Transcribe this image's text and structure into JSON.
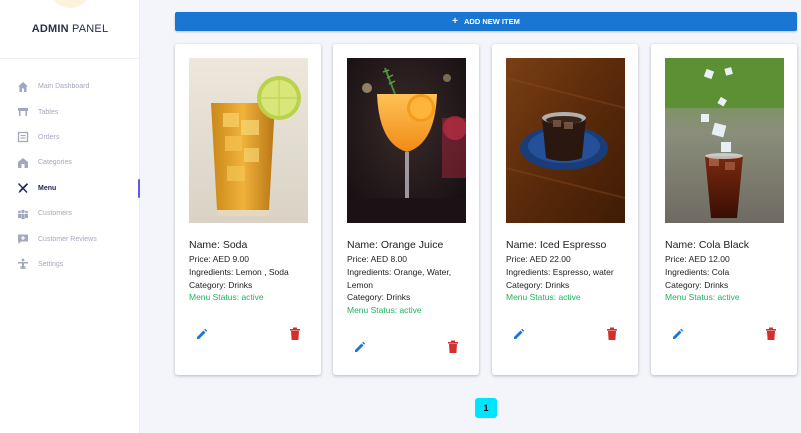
{
  "brand": {
    "bold": "ADMIN",
    "regular": " PANEL"
  },
  "nav": [
    {
      "label": "Main Dashboard",
      "icon": "home-icon"
    },
    {
      "label": "Tables",
      "icon": "table-icon"
    },
    {
      "label": "Orders",
      "icon": "orders-icon"
    },
    {
      "label": "Categories",
      "icon": "categories-icon"
    },
    {
      "label": "Menu",
      "icon": "utensils-icon",
      "active": true
    },
    {
      "label": "Customers",
      "icon": "customers-icon"
    },
    {
      "label": "Customer Reviews",
      "icon": "reviews-icon"
    },
    {
      "label": "Settings",
      "icon": "settings-icon"
    }
  ],
  "toolbar": {
    "add_label": "ADD NEW ITEM"
  },
  "items": [
    {
      "name": "Name: Soda",
      "price": "Price: AED 9.00",
      "ingredients": "Ingredients: Lemon , Soda",
      "category": "Category: Drinks",
      "status": "Menu Status: active"
    },
    {
      "name": "Name: Orange Juice",
      "price": "Price: AED 8.00",
      "ingredients": "Ingredients: Orange, Water, Lemon",
      "category": "Category: Drinks",
      "status": "Menu Status: active"
    },
    {
      "name": "Name: Iced Espresso",
      "price": "Price: AED 22.00",
      "ingredients": "Ingredients: Espresso, water",
      "category": "Category: Drinks",
      "status": "Menu Status: active"
    },
    {
      "name": "Name: Cola Black",
      "price": "Price: AED 12.00",
      "ingredients": "Ingredients: Cola",
      "category": "Category: Drinks",
      "status": "Menu Status: active"
    }
  ],
  "pagination": {
    "current": "1"
  },
  "colors": {
    "primary": "#1976d2",
    "active_status": "#22b35e",
    "delete": "#d32f2f",
    "pager": "#00e5ff",
    "nav_active": "#1f2554"
  }
}
